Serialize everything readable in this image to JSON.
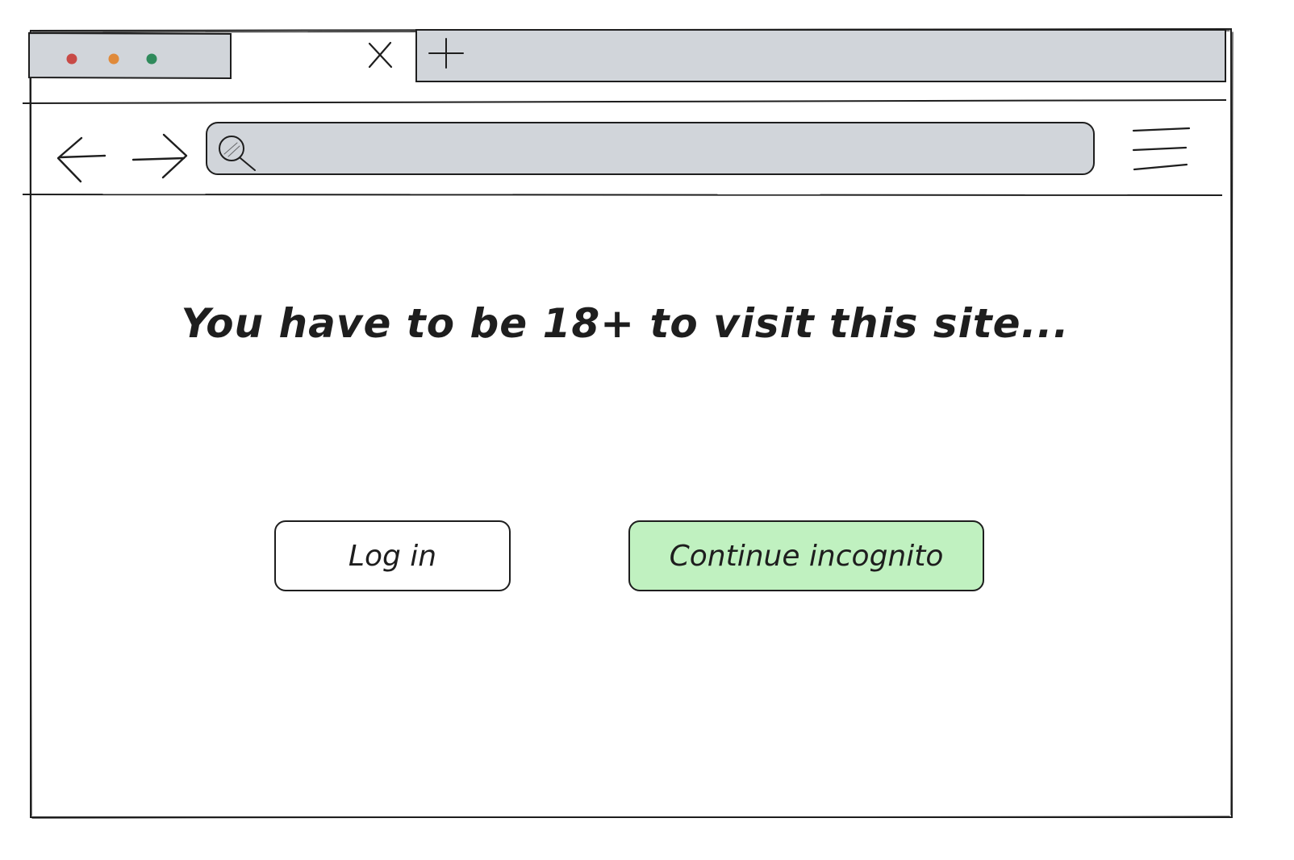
{
  "colors": {
    "ink": "#1e1e1e",
    "chrome_fill": "#d1d5da",
    "traffic_red": "#c84a46",
    "traffic_orange": "#e08a3a",
    "traffic_green": "#2f8a5b",
    "accent_green": "#c0f1c0"
  },
  "browser": {
    "icons": {
      "close_tab": "close-icon",
      "new_tab": "plus-icon",
      "back": "arrow-left-icon",
      "forward": "arrow-right-icon",
      "search": "search-icon",
      "menu": "hamburger-menu-icon"
    },
    "address_bar": {
      "value": "",
      "placeholder": ""
    }
  },
  "page": {
    "headline": "You have to be 18+ to visit this site...",
    "login_label": "Log in",
    "incognito_label": "Continue incognito"
  }
}
